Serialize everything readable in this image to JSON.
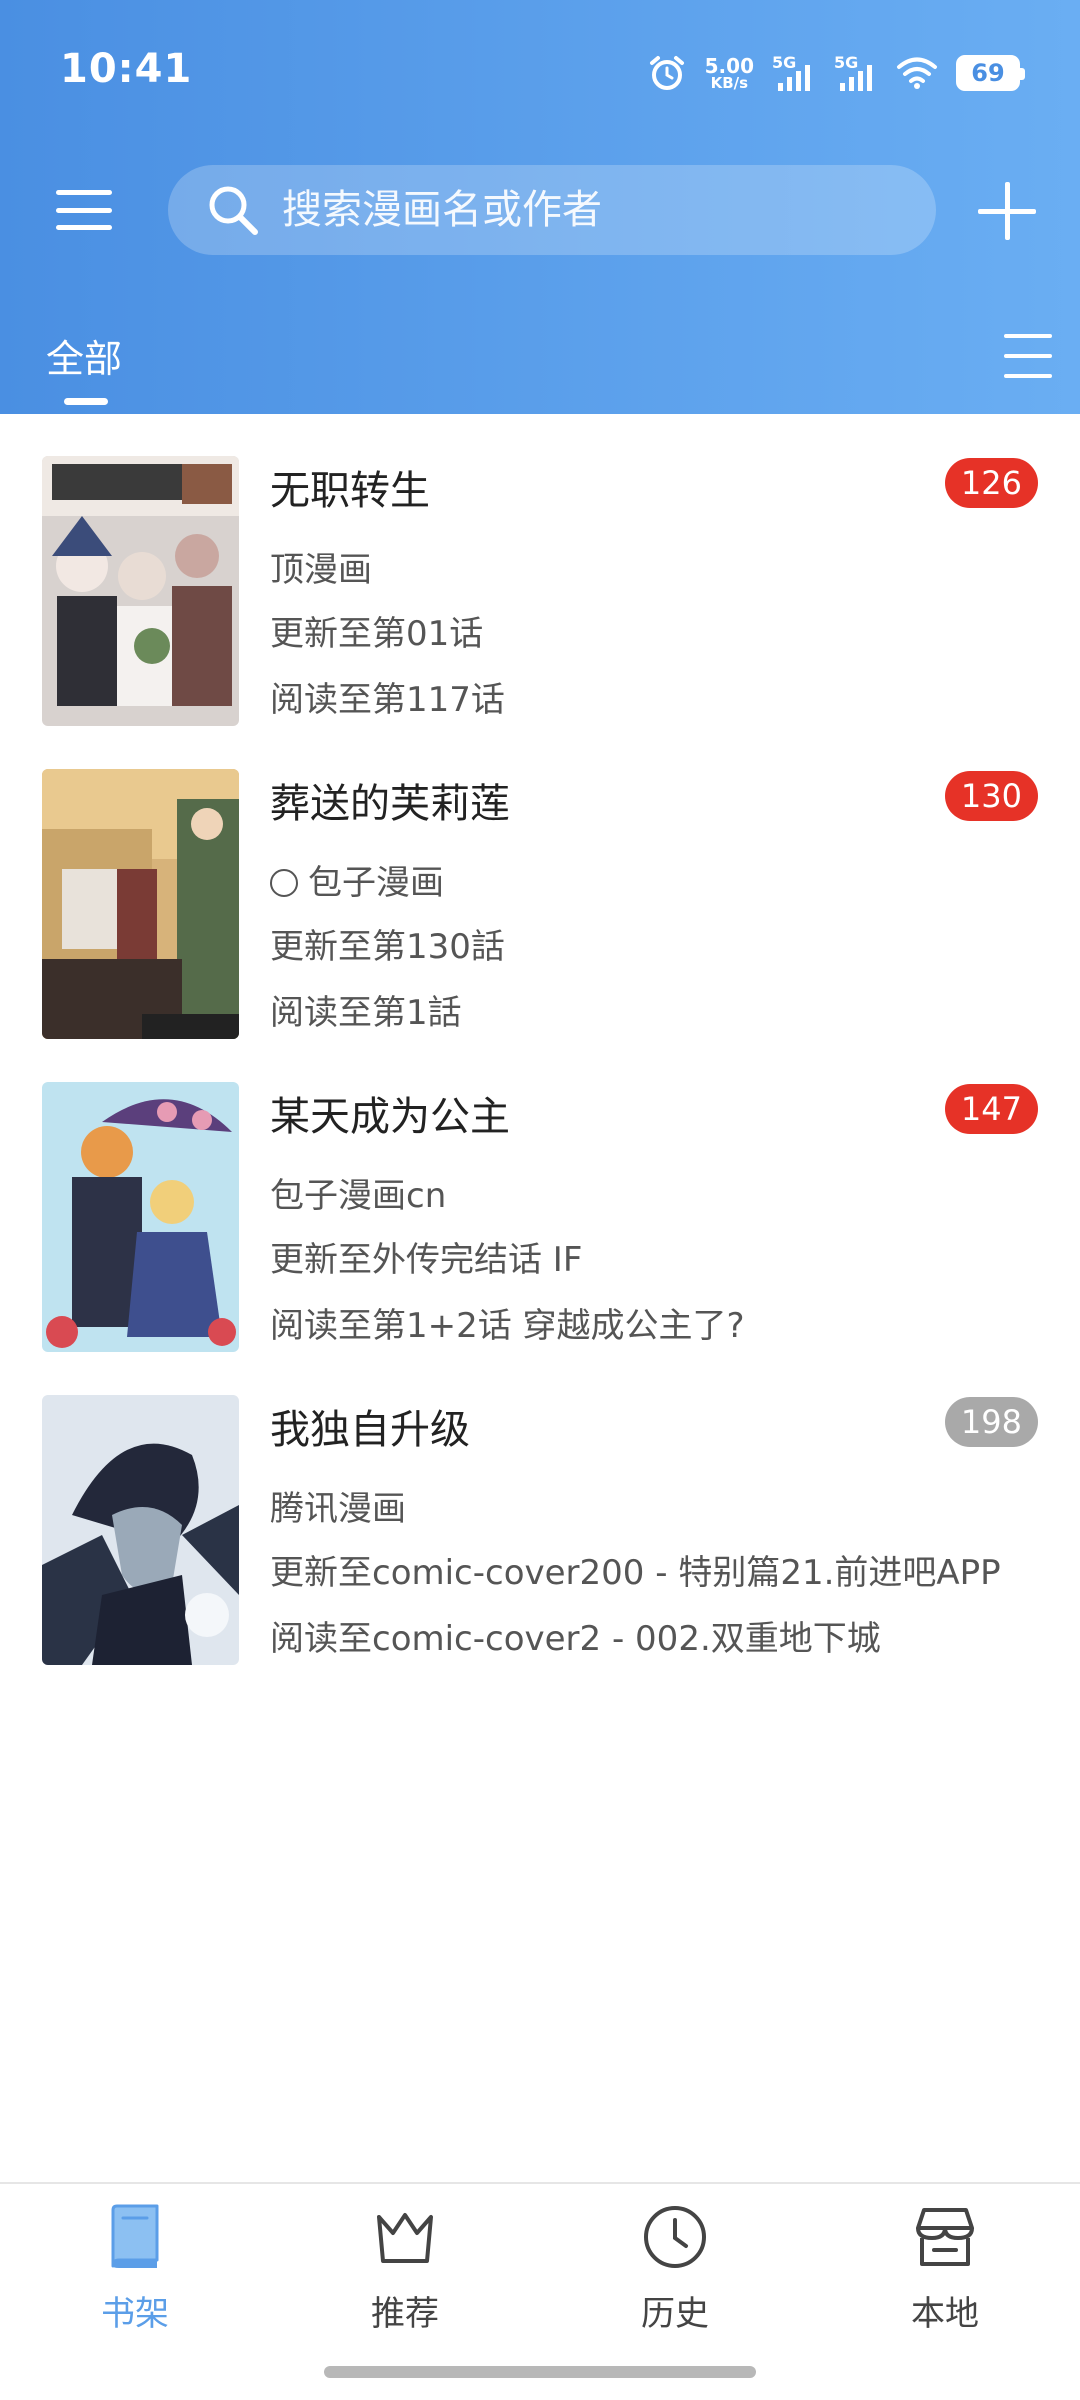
{
  "status_bar": {
    "time": "10:41",
    "net_speed_value": "5.00",
    "net_speed_unit": "KB/s",
    "sim1_label": "5G",
    "sim2_label": "5G",
    "battery": "69"
  },
  "toolbar": {
    "search_placeholder": "搜索漫画名或作者"
  },
  "tabs": {
    "all_label": "全部"
  },
  "comics": [
    {
      "title": "无职转生",
      "source": "顶漫画",
      "update": "更新至第01话",
      "read": "阅读至第117话",
      "count": "126",
      "badge_color": "#e63227"
    },
    {
      "title": "葬送的芙莉莲",
      "source": "包子漫画",
      "update": "更新至第130話",
      "read": "阅读至第1話",
      "count": "130",
      "badge_color": "#e63227"
    },
    {
      "title": "某天成为公主",
      "source": "包子漫画cn",
      "update": "更新至外传完结话 IF",
      "read": "阅读至第1+2话 穿越成公主了?",
      "count": "147",
      "badge_color": "#e63227"
    },
    {
      "title": "我独自升级",
      "source": "腾讯漫画",
      "update": "更新至comic-cover200 - 特别篇21.前进吧APP",
      "read": "阅读至comic-cover2 - 002.双重地下城",
      "count": "198",
      "badge_color": "#a9a9a9"
    }
  ],
  "bottom_nav": {
    "items": [
      {
        "label": "书架",
        "icon": "book-icon",
        "active": true
      },
      {
        "label": "推荐",
        "icon": "crown-icon",
        "active": false
      },
      {
        "label": "历史",
        "icon": "clock-icon",
        "active": false
      },
      {
        "label": "本地",
        "icon": "store-icon",
        "active": false
      }
    ]
  },
  "colors": {
    "header_start": "#4a8fe2",
    "header_end": "#6aaef3",
    "active_nav": "#5b9ee8"
  }
}
